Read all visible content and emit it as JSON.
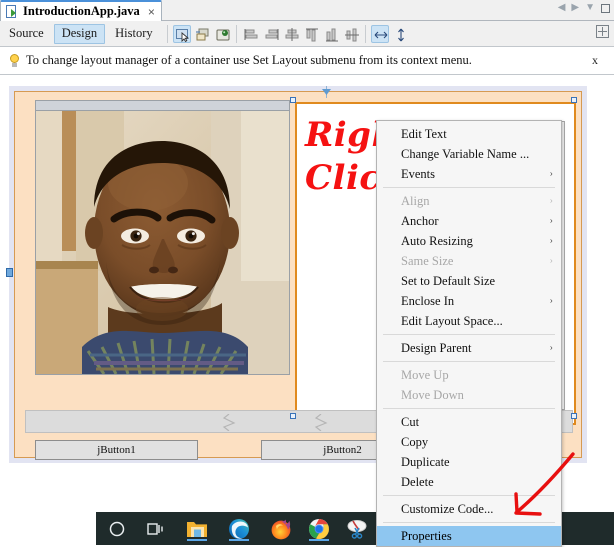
{
  "window": {
    "tab_title": "IntroductionApp.java",
    "tab_close": "×",
    "file_icon": "java-file-icon"
  },
  "nav": {
    "back": "◀",
    "forward": "▶",
    "dropdown": "▼",
    "maximize": "maximize-icon"
  },
  "toolbar": {
    "view_tabs": [
      {
        "label": "Source",
        "active": false
      },
      {
        "label": "Design",
        "active": true
      },
      {
        "label": "History",
        "active": false
      }
    ],
    "icons": [
      {
        "name": "selection-mode-icon",
        "selected": true
      },
      {
        "name": "connection-mode-icon",
        "selected": false
      },
      {
        "name": "preview-design-icon",
        "selected": false
      },
      {
        "name": "align-left-icon",
        "selected": false
      },
      {
        "name": "align-right-icon",
        "selected": false
      },
      {
        "name": "align-center-icon",
        "selected": false
      },
      {
        "name": "align-top-icon",
        "selected": false
      },
      {
        "name": "align-bottom-icon",
        "selected": false
      },
      {
        "name": "align-middle-icon",
        "selected": false
      },
      {
        "name": "auto-resize-horizontal-icon",
        "selected": true
      },
      {
        "name": "auto-resize-vertical-icon",
        "selected": false
      }
    ],
    "corner_icon": "expand-window-icon"
  },
  "hint": {
    "icon": "lightbulb-icon",
    "text": "To change layout manager of a container use Set Layout submenu from its context menu.",
    "close_label": "x"
  },
  "design": {
    "annotation_line1": "Right",
    "annotation_line2": "Click",
    "buttons": [
      {
        "label": "jButton1"
      },
      {
        "label": "jButton2"
      }
    ],
    "colors": {
      "frame_background": "#fce0c2",
      "selection_border": "#e08a1e",
      "canvas_background": "#e2e4f2",
      "annotation_red": "#f51212",
      "highlight_blue": "#8ec6f0"
    }
  },
  "context_menu": {
    "items": [
      {
        "label": "Edit Text",
        "disabled": false,
        "submenu": false,
        "selected": false
      },
      {
        "label": "Change Variable Name ...",
        "disabled": false,
        "submenu": false,
        "selected": false
      },
      {
        "label": "Events",
        "disabled": false,
        "submenu": true,
        "selected": false
      },
      {
        "separator": true
      },
      {
        "label": "Align",
        "disabled": true,
        "submenu": true,
        "selected": false
      },
      {
        "label": "Anchor",
        "disabled": false,
        "submenu": true,
        "selected": false
      },
      {
        "label": "Auto Resizing",
        "disabled": false,
        "submenu": true,
        "selected": false
      },
      {
        "label": "Same Size",
        "disabled": true,
        "submenu": true,
        "selected": false
      },
      {
        "label": "Set to Default Size",
        "disabled": false,
        "submenu": false,
        "selected": false
      },
      {
        "label": "Enclose In",
        "disabled": false,
        "submenu": true,
        "selected": false
      },
      {
        "label": "Edit Layout Space...",
        "disabled": false,
        "submenu": false,
        "selected": false
      },
      {
        "separator": true
      },
      {
        "label": "Design Parent",
        "disabled": false,
        "submenu": true,
        "selected": false
      },
      {
        "separator": true
      },
      {
        "label": "Move Up",
        "disabled": true,
        "submenu": false,
        "selected": false
      },
      {
        "label": "Move Down",
        "disabled": true,
        "submenu": false,
        "selected": false
      },
      {
        "separator": true
      },
      {
        "label": "Cut",
        "disabled": false,
        "submenu": false,
        "selected": false
      },
      {
        "label": "Copy",
        "disabled": false,
        "submenu": false,
        "selected": false
      },
      {
        "label": "Duplicate",
        "disabled": false,
        "submenu": false,
        "selected": false
      },
      {
        "label": "Delete",
        "disabled": false,
        "submenu": false,
        "selected": false
      },
      {
        "separator": true
      },
      {
        "label": "Customize Code...",
        "disabled": false,
        "submenu": false,
        "selected": false
      },
      {
        "separator": true
      },
      {
        "label": "Properties",
        "disabled": false,
        "submenu": false,
        "selected": true
      }
    ],
    "submenu_arrow": "›"
  },
  "taskbar": {
    "items": [
      {
        "name": "cortana-search-icon",
        "running": false
      },
      {
        "name": "task-view-icon",
        "running": false
      },
      {
        "name": "file-explorer-icon",
        "running": true
      },
      {
        "name": "microsoft-edge-icon",
        "running": true
      },
      {
        "name": "firefox-icon",
        "running": false
      },
      {
        "name": "google-chrome-icon",
        "running": true
      },
      {
        "name": "snipping-tool-icon",
        "running": false
      },
      {
        "name": "netbeans-icon",
        "running": true
      },
      {
        "name": "notepad-icon",
        "running": false
      }
    ]
  }
}
